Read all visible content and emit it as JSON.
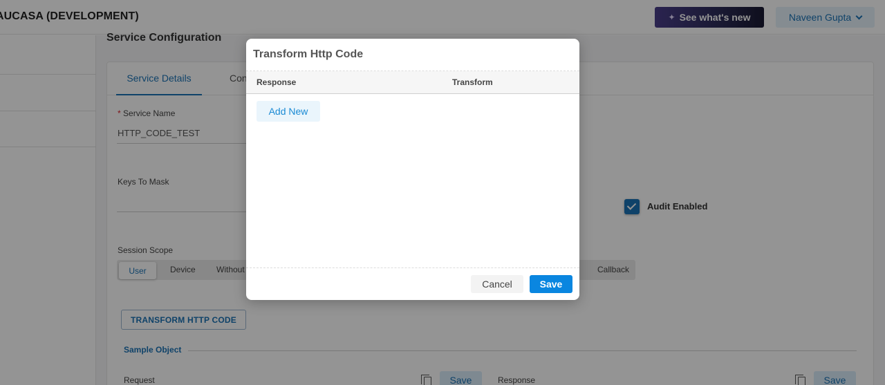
{
  "header": {
    "app_title": "AUCASA (DEVELOPMENT)",
    "whats_new_label": "See what's new",
    "user_name": "Naveen Gupta"
  },
  "page": {
    "section_title": "Service Configuration",
    "tabs": [
      {
        "label": "Service Details",
        "active": true
      },
      {
        "label": "Con",
        "active": false
      }
    ],
    "service_name_label": "Service Name",
    "service_name_value": "HTTP_CODE_TEST",
    "keys_to_mask_label": "Keys To Mask",
    "audit_enabled_label": "Audit Enabled",
    "audit_enabled_checked": true,
    "session_scope_label": "Session Scope",
    "session_scope_options": [
      "User",
      "Device",
      "Without",
      "Callback"
    ],
    "session_scope_selected": "User",
    "transform_button_label": "TRANSFORM HTTP CODE",
    "sample_object_title": "Sample Object",
    "request_label": "Request",
    "response_label": "Response",
    "save_label": "Save"
  },
  "modal": {
    "title": "Transform Http Code",
    "columns": [
      "Response",
      "Transform"
    ],
    "add_new_label": "Add New",
    "cancel_label": "Cancel",
    "save_label": "Save"
  },
  "colors": {
    "accent": "#1a73b5",
    "primary_button": "#0a86e0"
  }
}
